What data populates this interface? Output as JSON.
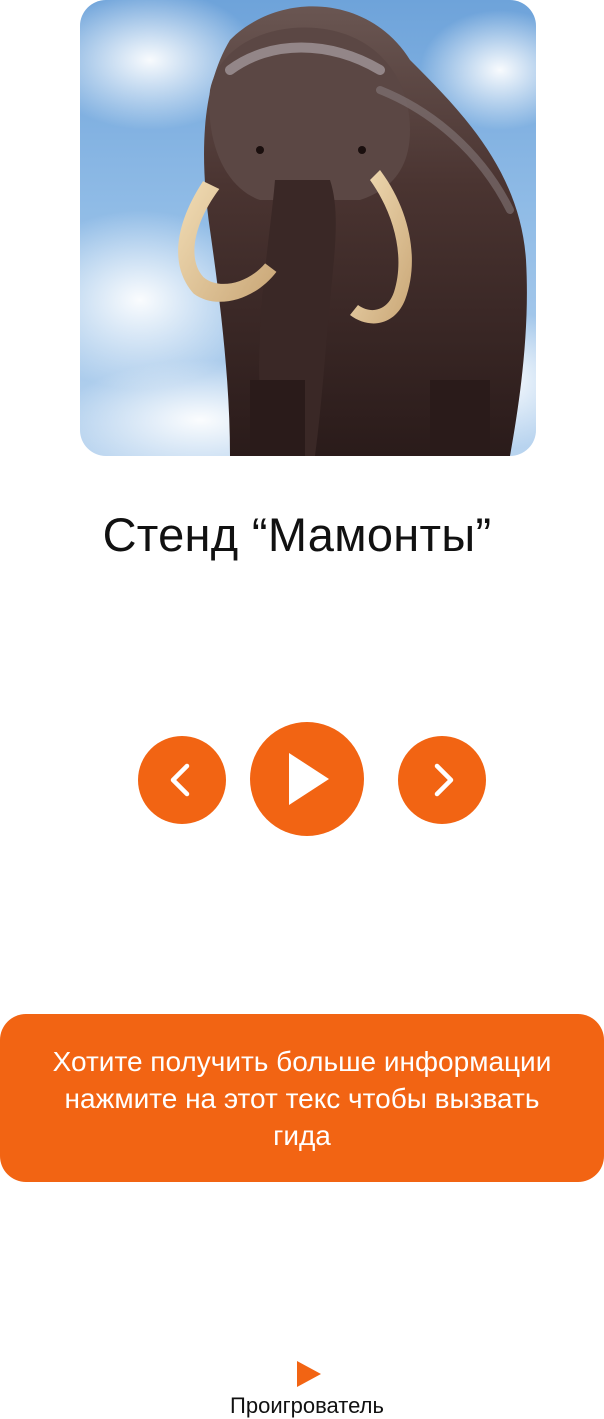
{
  "exhibit": {
    "image_subject": "woolly mammoth",
    "title": "Стенд “Мамонты”"
  },
  "player": {
    "prev_icon": "chevron-left-icon",
    "play_icon": "play-icon",
    "next_icon": "chevron-right-icon"
  },
  "guide_banner": {
    "text": "Хотите получить больше информации нажмите на этот текс чтобы вызвать гида"
  },
  "bottom_nav": {
    "player_label": "Проигрователь",
    "player_icon": "play-icon"
  },
  "colors": {
    "accent": "#f26413",
    "text": "#111111",
    "background": "#ffffff",
    "banner_text": "#ffffff"
  }
}
